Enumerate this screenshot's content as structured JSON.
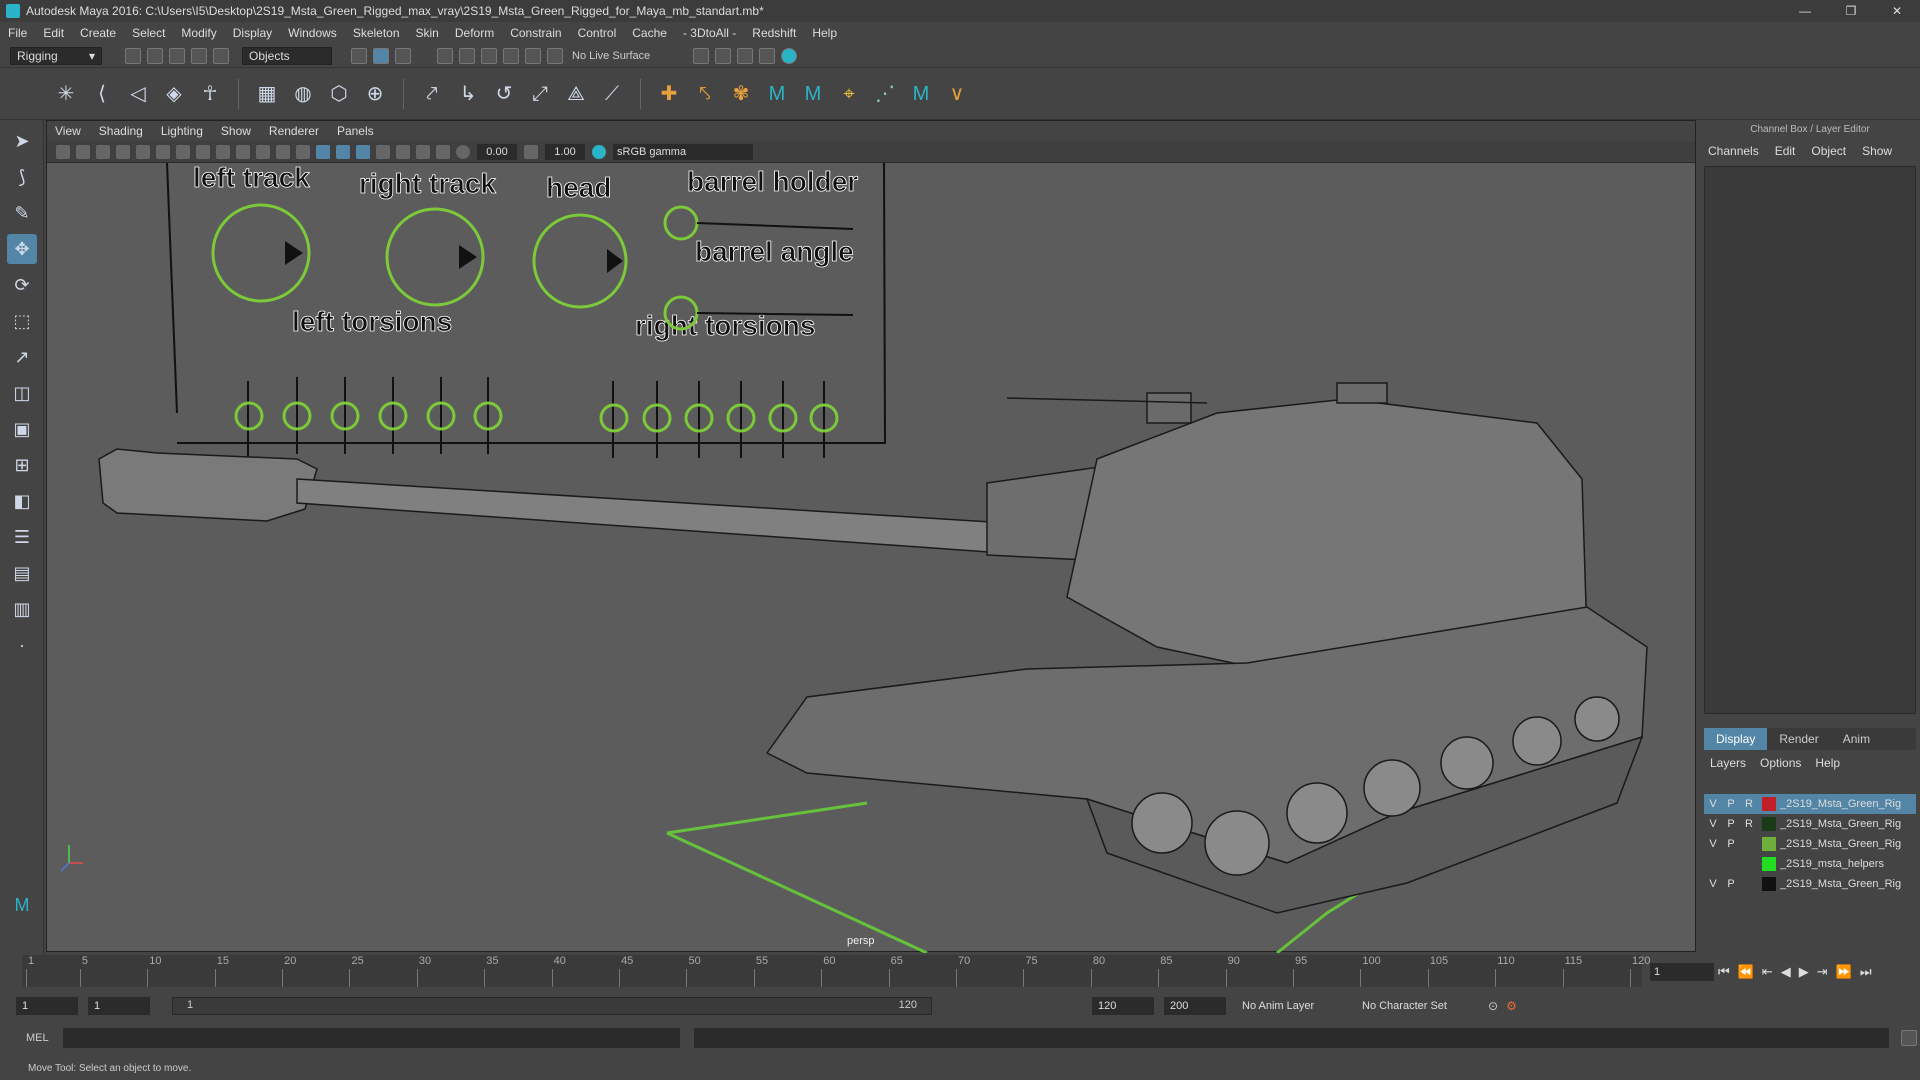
{
  "window": {
    "title": "Autodesk Maya 2016: C:\\Users\\I5\\Desktop\\2S19_Msta_Green_Rigged_max_vray\\2S19_Msta_Green_Rigged_for_Maya_mb_standart.mb*",
    "controls": [
      "—",
      "❐",
      "✕"
    ]
  },
  "menu": [
    "File",
    "Edit",
    "Create",
    "Select",
    "Modify",
    "Display",
    "Windows",
    "Skeleton",
    "Skin",
    "Deform",
    "Constrain",
    "Control",
    "Cache",
    "- 3DtoAll -",
    "Redshift",
    "Help"
  ],
  "statusline": {
    "mode": "Rigging",
    "selection_mode": "Objects",
    "live_surface": "No Live Surface"
  },
  "viewport": {
    "menu": [
      "View",
      "Shading",
      "Lighting",
      "Show",
      "Renderer",
      "Panels"
    ],
    "near_value": "0.00",
    "far_value": "1.00",
    "color_space": "sRGB gamma",
    "camera": "persp",
    "rig_labels": {
      "left_track": "left track",
      "right_track": "right track",
      "head": "head",
      "barrel_holder": "barrel holder",
      "barrel_angle": "barrel angle",
      "left_torsions": "left torsions",
      "right_torsions": "right torsions"
    },
    "colors": {
      "rig_controls": "#7cc93a",
      "ground_grid": "#66c23a",
      "background": "#5c5c5c"
    }
  },
  "right_panel": {
    "title": "Channel Box / Layer Editor",
    "tabs": [
      "Channels",
      "Edit",
      "Object",
      "Show"
    ],
    "layer_tabs": [
      "Display",
      "Render",
      "Anim"
    ],
    "layer_menu": [
      "Layers",
      "Options",
      "Help"
    ],
    "layers": [
      {
        "v": "V",
        "p": "P",
        "r": "R",
        "color": "#c0202a",
        "name": "_2S19_Msta_Green_Rig",
        "selected": true
      },
      {
        "v": "V",
        "p": "P",
        "r": "R",
        "color": "#1a3a1a",
        "name": "_2S19_Msta_Green_Rig",
        "selected": false
      },
      {
        "v": "V",
        "p": "P",
        "r": "",
        "color": "#6fae3a",
        "name": "_2S19_Msta_Green_Rig",
        "selected": false
      },
      {
        "v": "",
        "p": "",
        "r": "",
        "color": "#22dd22",
        "name": "_2S19_msta_helpers",
        "selected": false
      },
      {
        "v": "V",
        "p": "P",
        "r": "",
        "color": "#111111",
        "name": "_2S19_Msta_Green_Rig",
        "selected": false
      }
    ]
  },
  "timeline": {
    "ticks": [
      "1",
      "5",
      "10",
      "15",
      "20",
      "25",
      "30",
      "35",
      "40",
      "45",
      "50",
      "55",
      "60",
      "65",
      "70",
      "75",
      "80",
      "85",
      "90",
      "95",
      "100",
      "105",
      "110",
      "115",
      "120"
    ],
    "current_frame": "1"
  },
  "range": {
    "start": "1",
    "anim_start": "1",
    "slider_start": "1",
    "slider_end": "120",
    "anim_end": "120",
    "end": "200",
    "anim_layer": "No Anim Layer",
    "character_set": "No Character Set"
  },
  "cmdline": {
    "label": "MEL"
  },
  "helpline": "Move Tool: Select an object to move."
}
